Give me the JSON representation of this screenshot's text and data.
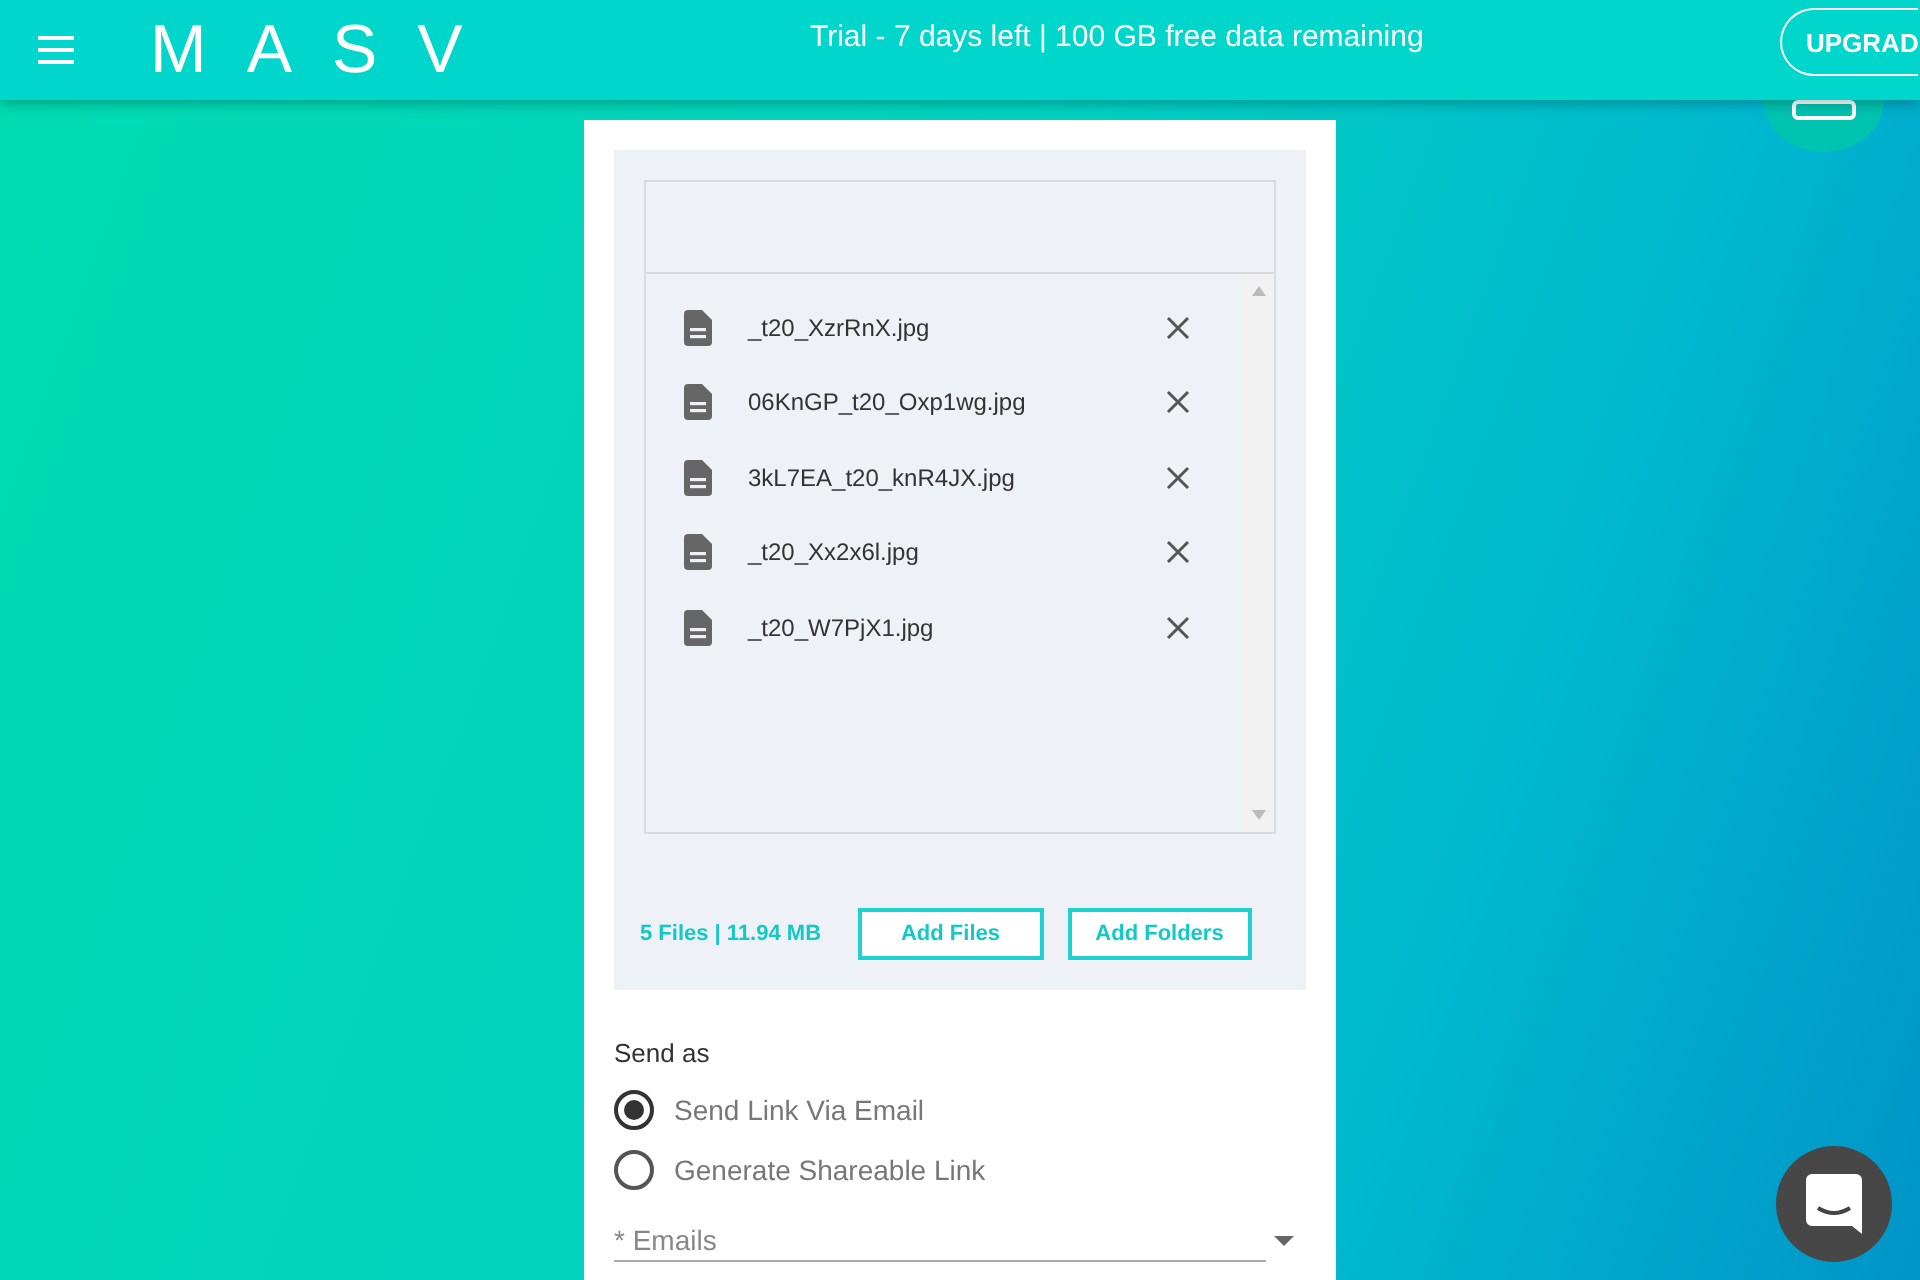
{
  "header": {
    "logo": "MASV",
    "trial_notice": "Trial - 7 days left | 100 GB free data remaining",
    "upgrade_button": "UPGRAD"
  },
  "files": [
    {
      "name": "_t20_XzrRnX.jpg"
    },
    {
      "name": "06KnGP_t20_Oxp1wg.jpg"
    },
    {
      "name": "3kL7EA_t20_knR4JX.jpg"
    },
    {
      "name": "_t20_Xx2x6l.jpg"
    },
    {
      "name": "_t20_W7PjX1.jpg"
    }
  ],
  "summary": "5 Files | 11.94 MB",
  "buttons": [
    "Add Files",
    "Add Folders"
  ],
  "send_as": {
    "label": "Send as",
    "options": [
      {
        "label": "Send Link Via Email",
        "selected": true
      },
      {
        "label": "Generate Shareable Link",
        "selected": false
      }
    ]
  },
  "emails_field": {
    "placeholder": "* Emails"
  }
}
